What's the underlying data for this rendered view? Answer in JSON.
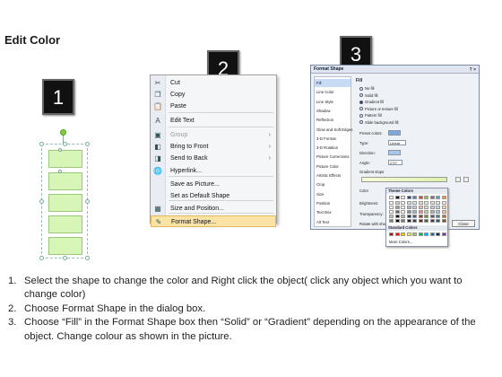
{
  "page_title": "Edit Color",
  "badges": [
    "1",
    "2",
    "3"
  ],
  "context_menu": {
    "items": [
      {
        "label": "Cut",
        "icon": "scissors-icon",
        "glyph": "✂",
        "submenu": false,
        "disabled": false
      },
      {
        "label": "Copy",
        "icon": "copy-icon",
        "glyph": "❐",
        "submenu": false,
        "disabled": false
      },
      {
        "label": "Paste",
        "icon": "paste-icon",
        "glyph": "📋",
        "submenu": false,
        "disabled": false
      },
      {
        "label": "Edit Text",
        "icon": "edit-text-icon",
        "glyph": "A",
        "submenu": false,
        "disabled": false
      },
      {
        "label": "Group",
        "icon": "group-icon",
        "glyph": "▣",
        "submenu": true,
        "disabled": true
      },
      {
        "label": "Bring to Front",
        "icon": "bring-front-icon",
        "glyph": "◧",
        "submenu": true,
        "disabled": false
      },
      {
        "label": "Send to Back",
        "icon": "send-back-icon",
        "glyph": "◨",
        "submenu": true,
        "disabled": false
      },
      {
        "label": "Hyperlink...",
        "icon": "hyperlink-icon",
        "glyph": "🌐",
        "submenu": false,
        "disabled": false
      },
      {
        "label": "Save as Picture...",
        "icon": "",
        "glyph": "",
        "submenu": false,
        "disabled": false
      },
      {
        "label": "Set as Default Shape",
        "icon": "",
        "glyph": "",
        "submenu": false,
        "disabled": false
      },
      {
        "label": "Size and Position...",
        "icon": "size-position-icon",
        "glyph": "▦",
        "submenu": false,
        "disabled": false
      },
      {
        "label": "Format Shape...",
        "icon": "format-shape-icon",
        "glyph": "✎",
        "submenu": false,
        "disabled": false
      }
    ]
  },
  "dialog": {
    "title": "Format Shape",
    "window_buttons": "? ×",
    "nav_items": [
      "Fill",
      "Line Color",
      "Line Style",
      "Shadow",
      "Reflection",
      "Glow and Soft Edges",
      "3-D Format",
      "3-D Rotation",
      "Picture Corrections",
      "Picture Color",
      "Artistic Effects",
      "Crop",
      "Size",
      "Position",
      "Text Box",
      "Alt Text"
    ],
    "selected_nav": "Fill",
    "pane_heading": "Fill",
    "fill_options": [
      {
        "label": "No fill",
        "selected": false
      },
      {
        "label": "Solid fill",
        "selected": false
      },
      {
        "label": "Gradient fill",
        "selected": true
      },
      {
        "label": "Picture or texture fill",
        "selected": false
      },
      {
        "label": "Pattern fill",
        "selected": false
      },
      {
        "label": "Slide background fill",
        "selected": false
      }
    ],
    "preset_colors_label": "Preset colors:",
    "type_label": "Type:",
    "type_value": "Linear",
    "direction_label": "Direction:",
    "angle_label": "Angle:",
    "angle_value": "270°",
    "gradient_stops_label": "Gradient stops",
    "color_label": "Color",
    "position_label": "Position:",
    "position_value": "0%",
    "brightness_label": "Brightness:",
    "transparency_label": "Transparency:",
    "rotate_label": "Rotate with shape",
    "close_label": "Close"
  },
  "palette": {
    "theme_heading": "Theme Colors",
    "standard_heading": "Standard Colors",
    "more_label": "More Colors...",
    "theme_top": [
      "#ffffff",
      "#000000",
      "#eeece1",
      "#1f497d",
      "#4f81bd",
      "#c0504d",
      "#9bbb59",
      "#8064a2",
      "#4bacc6",
      "#f79646"
    ],
    "standard": [
      "#c00000",
      "#ff0000",
      "#ffc000",
      "#ffff00",
      "#92d050",
      "#00b050",
      "#00b0f0",
      "#0070c0",
      "#002060",
      "#7030a0"
    ]
  },
  "instructions": [
    {
      "num": "1.",
      "text": "Select the shape to change the color and Right click the object( click any object which you want to change color)"
    },
    {
      "num": "2.",
      "text": "Choose Format Shape in the dialog box."
    },
    {
      "num": "3.",
      "text": "Choose “Fill” in the Format Shape box then “Solid” or “Gradient” depending on the appearance of the object. Change colour as shown in the picture."
    }
  ]
}
